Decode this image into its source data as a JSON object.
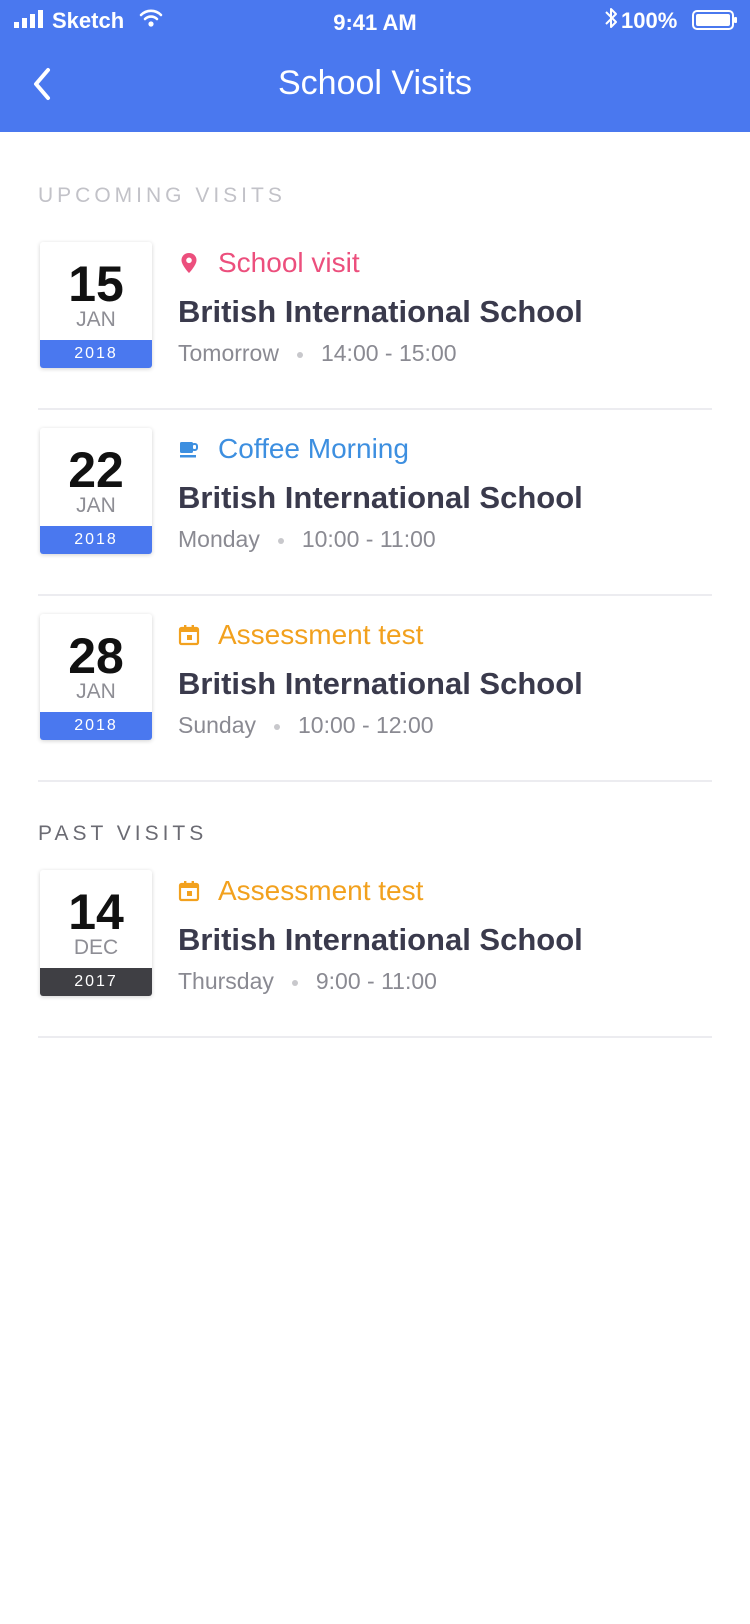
{
  "status_bar": {
    "carrier": "Sketch",
    "time": "9:41 AM",
    "battery": "100%"
  },
  "nav": {
    "title": "School Visits",
    "back_icon": "chevron-left-icon"
  },
  "sections": {
    "upcoming_title": "UPCOMING VISITS",
    "past_title": "PAST VISITS"
  },
  "colors": {
    "header": "#4a78ef",
    "upcoming_year_band": "#4a78ef",
    "past_year_band": "#3f3f44",
    "school_visit": "#ec4f7d",
    "coffee_morning": "#3d8fe0",
    "assessment_test": "#f2a11e"
  },
  "upcoming": [
    {
      "day": "15",
      "month": "JAN",
      "year": "2018",
      "type": "School visit",
      "icon": "map-pin-icon",
      "school": "British International School",
      "when": "Tomorrow",
      "time": "14:00 - 15:00"
    },
    {
      "day": "22",
      "month": "JAN",
      "year": "2018",
      "type": "Coffee Morning",
      "icon": "coffee-cup-icon",
      "school": "British International School",
      "when": "Monday",
      "time": "10:00 - 11:00"
    },
    {
      "day": "28",
      "month": "JAN",
      "year": "2018",
      "type": "Assessment test",
      "icon": "calendar-icon",
      "school": "British International School",
      "when": "Sunday",
      "time": "10:00 - 12:00"
    }
  ],
  "past": [
    {
      "day": "14",
      "month": "DEC",
      "year": "2017",
      "type": "Assessment test",
      "icon": "calendar-icon",
      "school": "British International School",
      "when": "Thursday",
      "time": "9:00 - 11:00"
    }
  ]
}
